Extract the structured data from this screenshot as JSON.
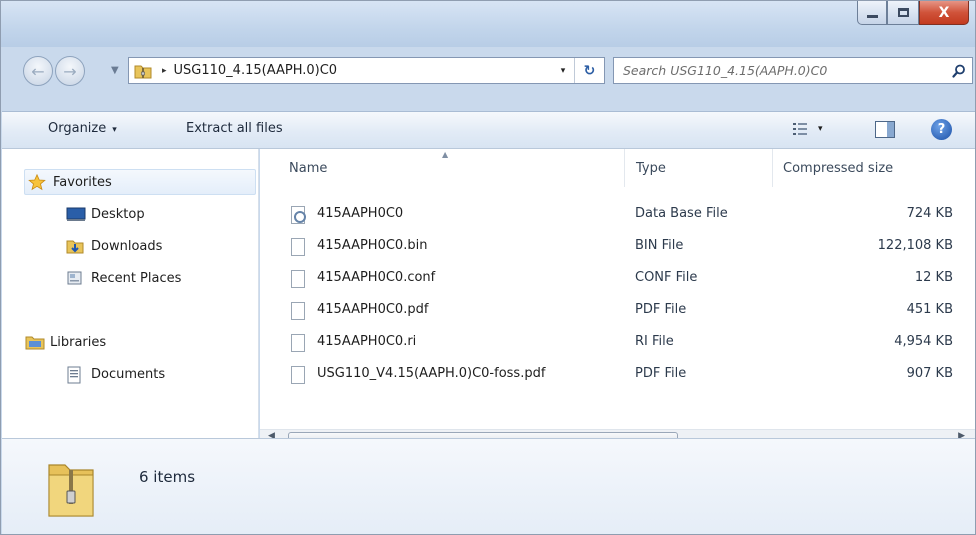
{
  "window": {
    "controls": {
      "minimize": "─",
      "maximize": "□",
      "close": "X"
    }
  },
  "address_bar": {
    "separator": "▸",
    "path": "USG110_4.15(AAPH.0)C0",
    "dropdown_glyph": "▾",
    "refresh_glyph": "↻"
  },
  "search": {
    "placeholder": "Search USG110_4.15(AAPH.0)C0"
  },
  "toolbar": {
    "organize_label": "Organize",
    "extract_label": "Extract all files",
    "dropdown_glyph": "▾",
    "help_glyph": "?"
  },
  "nav_pane": {
    "favorites": "Favorites",
    "desktop": "Desktop",
    "downloads": "Downloads",
    "recent_places": "Recent Places",
    "libraries": "Libraries",
    "documents": "Documents"
  },
  "columns": {
    "name": "Name",
    "type": "Type",
    "size": "Compressed size"
  },
  "files": [
    {
      "name": "415AAPH0C0",
      "type": "Data Base File",
      "size": "724 KB",
      "icon": "database-file-icon"
    },
    {
      "name": "415AAPH0C0.bin",
      "type": "BIN File",
      "size": "122,108 KB",
      "icon": "file-icon"
    },
    {
      "name": "415AAPH0C0.conf",
      "type": "CONF File",
      "size": "12 KB",
      "icon": "file-icon"
    },
    {
      "name": "415AAPH0C0.pdf",
      "type": "PDF File",
      "size": "451 KB",
      "icon": "file-icon"
    },
    {
      "name": "415AAPH0C0.ri",
      "type": "RI File",
      "size": "4,954 KB",
      "icon": "file-icon"
    },
    {
      "name": "USG110_V4.15(AAPH.0)C0-foss.pdf",
      "type": "PDF File",
      "size": "907 KB",
      "icon": "file-icon"
    }
  ],
  "status": {
    "item_count": "6 items"
  },
  "colors": {
    "frame": "#c9d9ec",
    "close_button": "#c33a1f",
    "link_blue": "#2b5da4"
  }
}
